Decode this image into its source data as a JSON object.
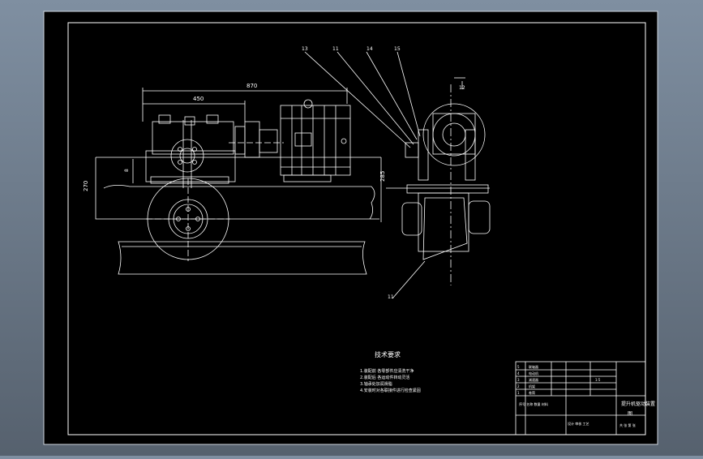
{
  "colors": {
    "viewport_top": "#7f8fa1",
    "viewport_bottom": "#56616e",
    "sheet": "#000000",
    "linework": "#ffffff",
    "accent_green": "#00ff66"
  },
  "dimensions": {
    "overall_length": "870",
    "reducer_length": "450",
    "height_left": "270",
    "height_right": "285",
    "small_height": "8",
    "side_offset": "12"
  },
  "callouts": [
    "13",
    "11",
    "14",
    "15",
    "11"
  ],
  "technical_requirements": {
    "title": "技术要求",
    "items": [
      "1.装配前  各零部件应清洗干净",
      "2.装配后  各运动件转动灵活",
      "3.轴承处加润滑脂",
      "4.安装时对各联接件进行检查紧固"
    ]
  },
  "title_block": {
    "drawing_name": "提升机驱动装置",
    "drawing_name_line2": "图",
    "sheet_note": "共 张 第 张",
    "rows": [
      {
        "no": "5",
        "name": "联轴器"
      },
      {
        "no": "4",
        "name": "电动机"
      },
      {
        "no": "3",
        "name": "减速器"
      },
      {
        "no": "2",
        "name": "机架"
      },
      {
        "no": "1",
        "name": "卷筒"
      }
    ],
    "header": "序号  名称  数量  材料",
    "signature_row": "设计  审核  工艺",
    "scale": "1:5"
  }
}
